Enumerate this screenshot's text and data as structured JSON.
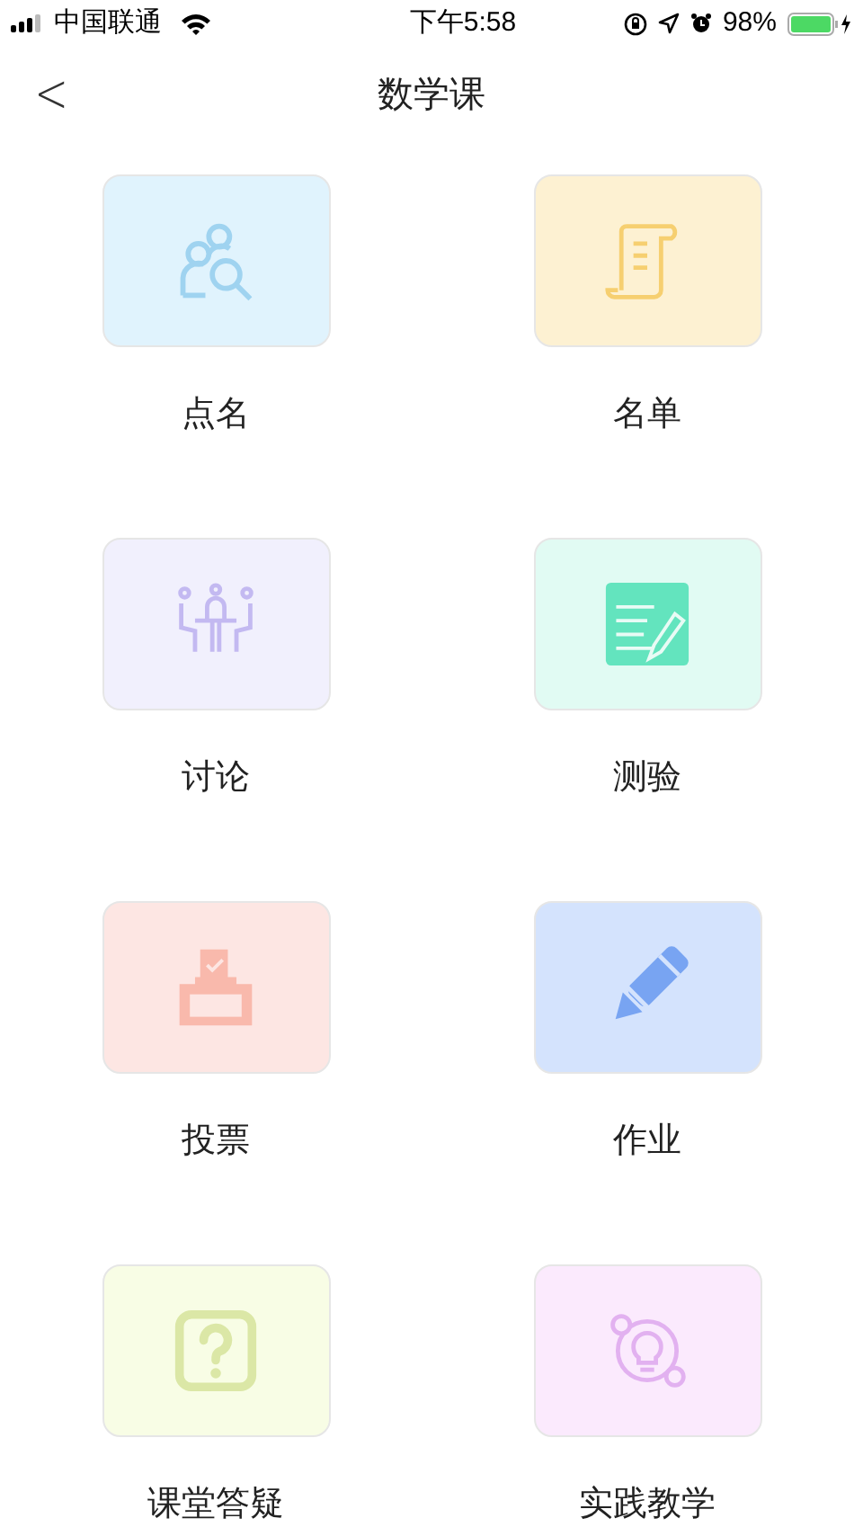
{
  "status_bar": {
    "carrier": "中国联通",
    "time": "下午5:58",
    "battery": "98%"
  },
  "nav": {
    "back": "<",
    "title": "数学课"
  },
  "tiles": [
    {
      "label": "点名",
      "color": "#e0f3fd"
    },
    {
      "label": "名单",
      "color": "#fdf1d2"
    },
    {
      "label": "讨论",
      "color": "#f1f0fd"
    },
    {
      "label": "测验",
      "color": "#e1fbf3"
    },
    {
      "label": "投票",
      "color": "#fde6e3"
    },
    {
      "label": "作业",
      "color": "#d4e3fd"
    },
    {
      "label": "课堂答疑",
      "color": "#f8fde5"
    },
    {
      "label": "实践教学",
      "color": "#fbeafd"
    }
  ]
}
